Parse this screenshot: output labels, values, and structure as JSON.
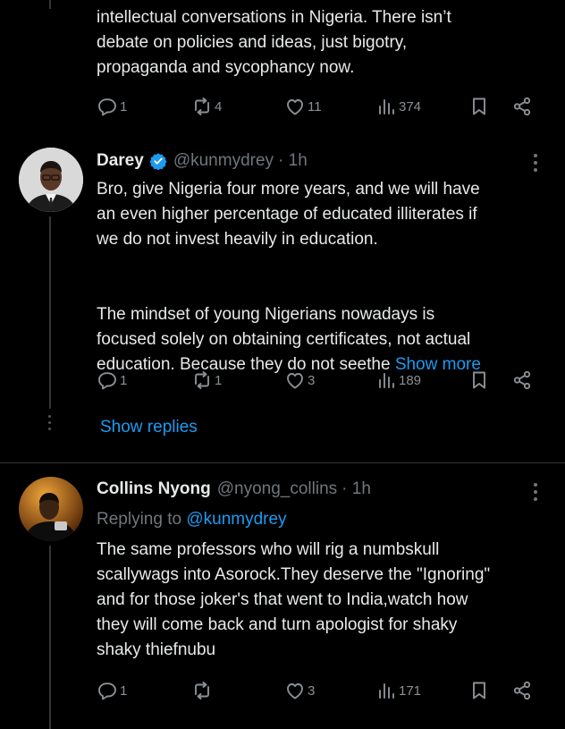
{
  "tweet0": {
    "text": "intellectual conversations in Nigeria. There isn’t\ndebate on policies and ideas, just bigotry,\npropaganda and sycophancy now.",
    "replies": "1",
    "reposts": "4",
    "likes": "11",
    "views": "374"
  },
  "tweet1": {
    "name": "Darey",
    "handle": "@kunmydrey",
    "time": "· 1h",
    "verified": true,
    "text_para1": "Bro, give Nigeria four more years, and we will have\nan even higher percentage of educated illiterates if\nwe do not invest heavily in education.",
    "text_para2": "The mindset of young Nigerians nowadays is\nfocused solely on obtaining certificates, not actual\neducation. Because they do not seethe",
    "show_more": "Show more",
    "replies": "1",
    "reposts": "1",
    "likes": "3",
    "views": "189",
    "show_replies": "Show replies"
  },
  "tweet2": {
    "name": "Collins Nyong",
    "handle": "@nyong_collins",
    "time": "· 1h",
    "replying_prefix": "Replying to",
    "replying_to": "@kunmydrey",
    "text": "The same professors who will rig a numbskull\nscallywags into Asorock.They deserve the \"Ignoring\"\nand for those joker's that went to India,watch how\nthey will come back and turn apologist for shaky\nshaky thiefnubu",
    "replies": "1",
    "reposts": "",
    "likes": "3",
    "views": "171"
  },
  "colors": {
    "background": "#000000",
    "text": "#e7e9ea",
    "muted": "#71767b",
    "link": "#1d9bf0",
    "verified": "#1d9bf0"
  }
}
